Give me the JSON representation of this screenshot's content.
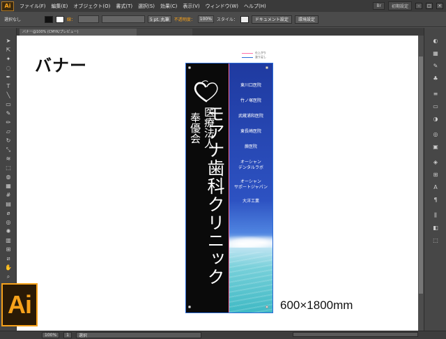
{
  "app": {
    "logo": "Ai"
  },
  "menubar": {
    "items": [
      "ファイル(F)",
      "編集(E)",
      "オブジェクト(O)",
      "書式(T)",
      "選択(S)",
      "効果(C)",
      "表示(V)",
      "ウィンドウ(W)",
      "ヘルプ(H)"
    ],
    "workspace": "初期設定"
  },
  "controlbar": {
    "selection": "選択なし",
    "stroke_label": "線：",
    "brush": "5 pt. 丸筆",
    "opacity_label": "不透明度：",
    "opacity_value": "100%",
    "style_label": "スタイル：",
    "doc_settings": "ドキュメント設定",
    "env_settings": "環境設定"
  },
  "tabs": {
    "active": "バナー@100% (CMYK/プレビュー)"
  },
  "canvas": {
    "heading": "バナー",
    "legend": [
      {
        "label": "仕上がり",
        "color": "#ff6fa8"
      },
      {
        "label": "塗り足し",
        "color": "#2a6ad8"
      }
    ],
    "clinic_name": "モアナ歯科クリニック",
    "corp_line1": "医療法人",
    "corp_line2": "奉優会",
    "clinics": [
      "東川口医院",
      "竹ノ塚医院",
      "武蔵浦和医院",
      "東長崎医院",
      "蕨医院",
      "オーシャン\nデンタルラボ",
      "オーシャン\nサポートジャパン",
      "大洋工業"
    ],
    "size": "600×1800mm"
  },
  "statusbar": {
    "zoom": "100%",
    "page": "1",
    "tool": "選択"
  },
  "colors": {
    "banner_left": "#0a0a0a",
    "banner_right_top": "#1f3aa0",
    "ai_orange": "#f7a21b",
    "bleed_guide": "#2a6ad8",
    "trim_guide": "#ff6fa8"
  },
  "icons": [
    "selection-tool",
    "direct-selection-tool",
    "magic-wand-tool",
    "lasso-tool",
    "pen-tool",
    "type-tool",
    "line-tool",
    "rectangle-tool",
    "brush-tool",
    "pencil-tool",
    "eraser-tool",
    "rotate-tool",
    "scale-tool",
    "warp-tool",
    "free-transform-tool",
    "symbol-sprayer-tool",
    "graph-tool",
    "mesh-tool",
    "gradient-tool",
    "eyedropper-tool",
    "blend-tool",
    "artboard-tool",
    "slice-tool",
    "hand-tool",
    "zoom-tool",
    "fill-stroke"
  ]
}
